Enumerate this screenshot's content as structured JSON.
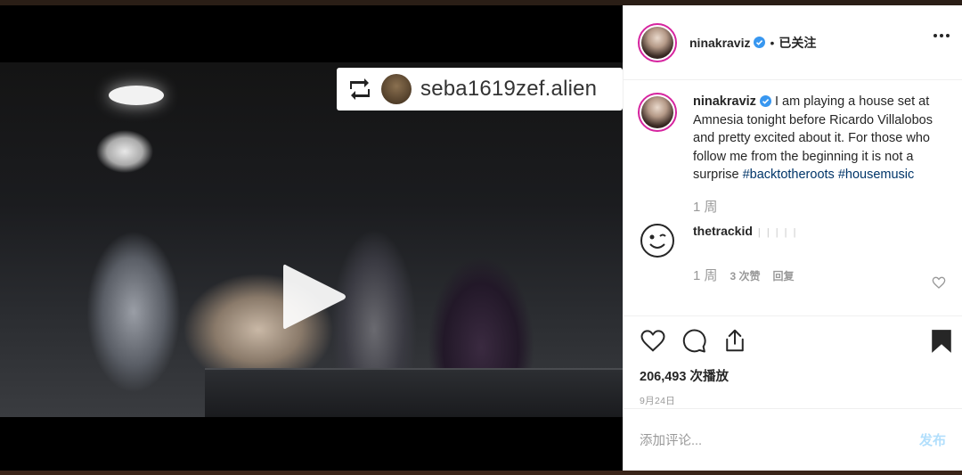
{
  "video": {
    "repost_username": "seba1619zef.alien"
  },
  "header": {
    "username": "ninakraviz",
    "separator": "•",
    "follow_status": "已关注"
  },
  "caption": {
    "username": "ninakraviz",
    "text": "I am playing a house set at Amnesia tonight before Ricardo Villalobos and pretty excited about it. For those who follow me from the beginning it is not a surprise",
    "hashtags": [
      "#backtotheroots",
      "#housemusic"
    ],
    "age": "1 周"
  },
  "comment": {
    "username": "thetrackid",
    "text": "| | | | |",
    "age": "1 周",
    "likes": "3 次赞",
    "reply": "回复"
  },
  "stats": {
    "views": "206,493 次播放",
    "date": "9月24日"
  },
  "add_comment": {
    "placeholder": "添加评论...",
    "post_label": "发布"
  },
  "colors": {
    "verified": "#3897f0",
    "hashtag": "#003569",
    "avatar_ring": "#d6249f",
    "post_disabled": "#b2dffc"
  }
}
